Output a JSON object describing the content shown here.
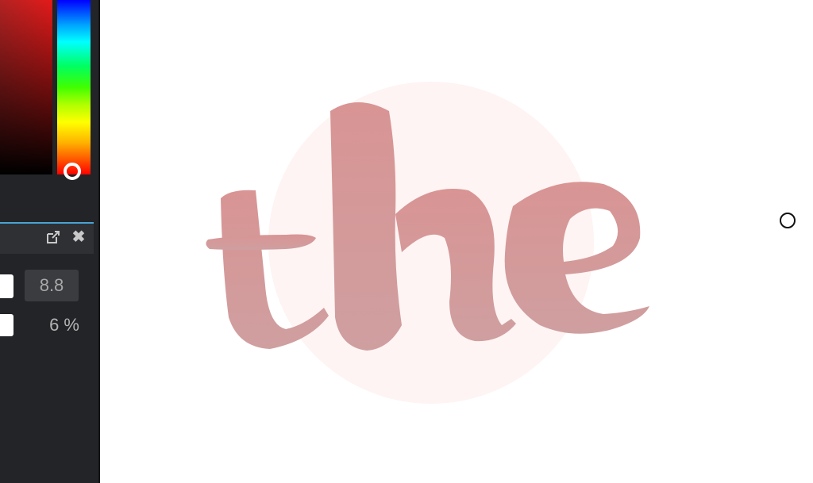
{
  "color_picker": {
    "saturation_area_color": "#e31a1a",
    "hue_selected": "red"
  },
  "panel": {
    "popout_icon": "popout-icon",
    "close_icon": "close-icon",
    "value": "8.8",
    "percent": "6 %"
  },
  "canvas": {
    "artwork_text": "the",
    "text_color": "#d69696",
    "circle_color": "#fdf4f3"
  }
}
